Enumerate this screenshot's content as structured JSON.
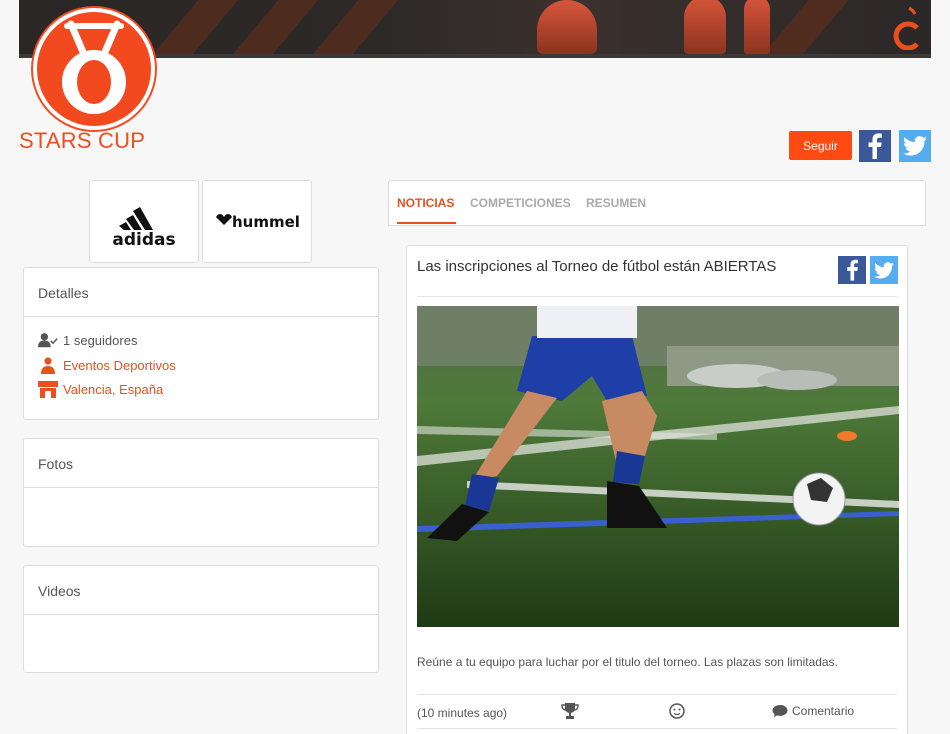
{
  "club": {
    "title": "STARS CUP"
  },
  "actions": {
    "follow_label": "Seguir",
    "facebook_icon": "facebook-icon",
    "twitter_icon": "twitter-icon"
  },
  "sponsors": [
    {
      "name": "adidas"
    },
    {
      "name": "hummel"
    }
  ],
  "details": {
    "heading": "Detalles",
    "followers": "1 seguidores",
    "category": "Eventos Deportivos",
    "location": "Valencia, España"
  },
  "photos": {
    "heading": "Fotos"
  },
  "videos": {
    "heading": "Videos"
  },
  "tabs": [
    {
      "label": "NOTICIAS",
      "active": true
    },
    {
      "label": "COMPETICIONES",
      "active": false
    },
    {
      "label": "RESUMEN",
      "active": false
    }
  ],
  "post": {
    "title": "Las inscripciones al Torneo de fútbol están ABIERTAS",
    "text": "Reúne a tu equipo para luchar por el titulo del torneo. Las plazas son  limitadas.",
    "time": "(10 minutes ago)",
    "comment_label": "Comentario"
  },
  "colors": {
    "accent": "#e8501e",
    "button": "#ff4a12",
    "facebook": "#3b5998",
    "twitter": "#55acee"
  }
}
